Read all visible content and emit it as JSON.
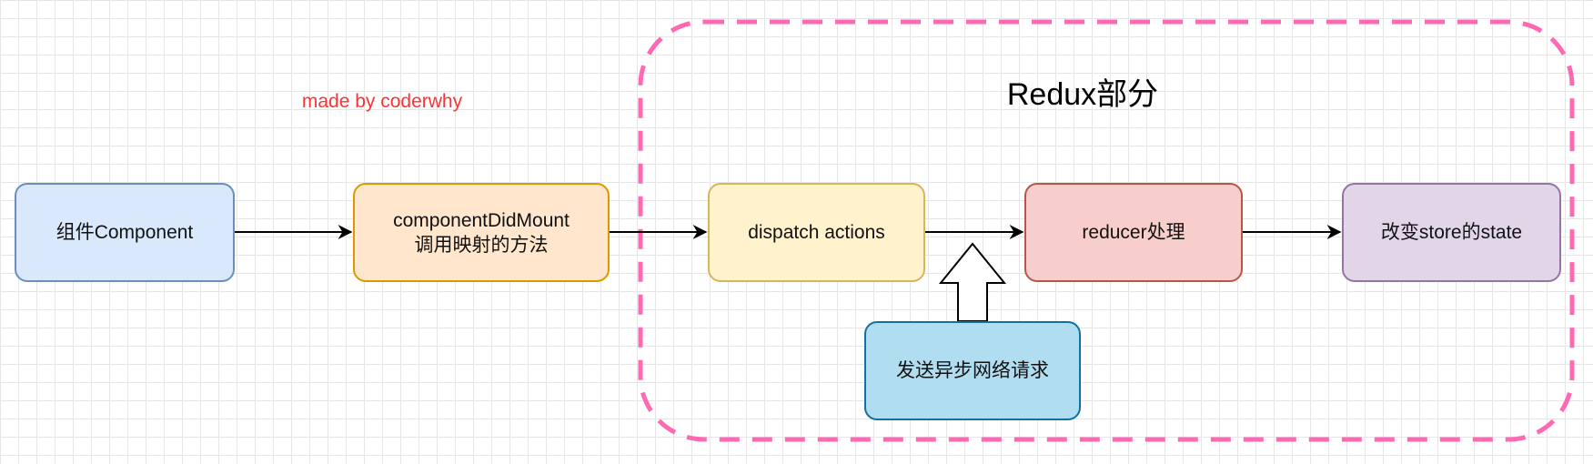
{
  "diagram": {
    "region": {
      "title": "Redux部分",
      "border_color": "#ff69b4"
    },
    "watermark": {
      "text": "made by coderwhy",
      "color": "#ff3333"
    },
    "nodes": [
      {
        "id": "component",
        "label": "组件Component",
        "fill": "#dae8fc",
        "stroke": "#6c8ebf"
      },
      {
        "id": "did-mount",
        "label": "componentDidMount\n调用映射的方法",
        "fill": "#ffe6cc",
        "stroke": "#d79b00"
      },
      {
        "id": "dispatch",
        "label": "dispatch actions",
        "fill": "#fff2cc",
        "stroke": "#d6b656"
      },
      {
        "id": "reducer",
        "label": "reducer处理",
        "fill": "#f8cecc",
        "stroke": "#b85450"
      },
      {
        "id": "state",
        "label": "改变store的state",
        "fill": "#e1d5e7",
        "stroke": "#9673a6"
      },
      {
        "id": "async",
        "label": "发送异步网络请求",
        "fill": "#b1ddf0",
        "stroke": "#10739e"
      }
    ],
    "edges": [
      {
        "from": "component",
        "to": "did-mount",
        "style": "arrow"
      },
      {
        "from": "did-mount",
        "to": "dispatch",
        "style": "arrow"
      },
      {
        "from": "dispatch",
        "to": "reducer",
        "style": "arrow"
      },
      {
        "from": "reducer",
        "to": "state",
        "style": "arrow"
      },
      {
        "from": "async",
        "to": "dispatch-reducer-edge",
        "style": "block-arrow-up"
      }
    ]
  }
}
